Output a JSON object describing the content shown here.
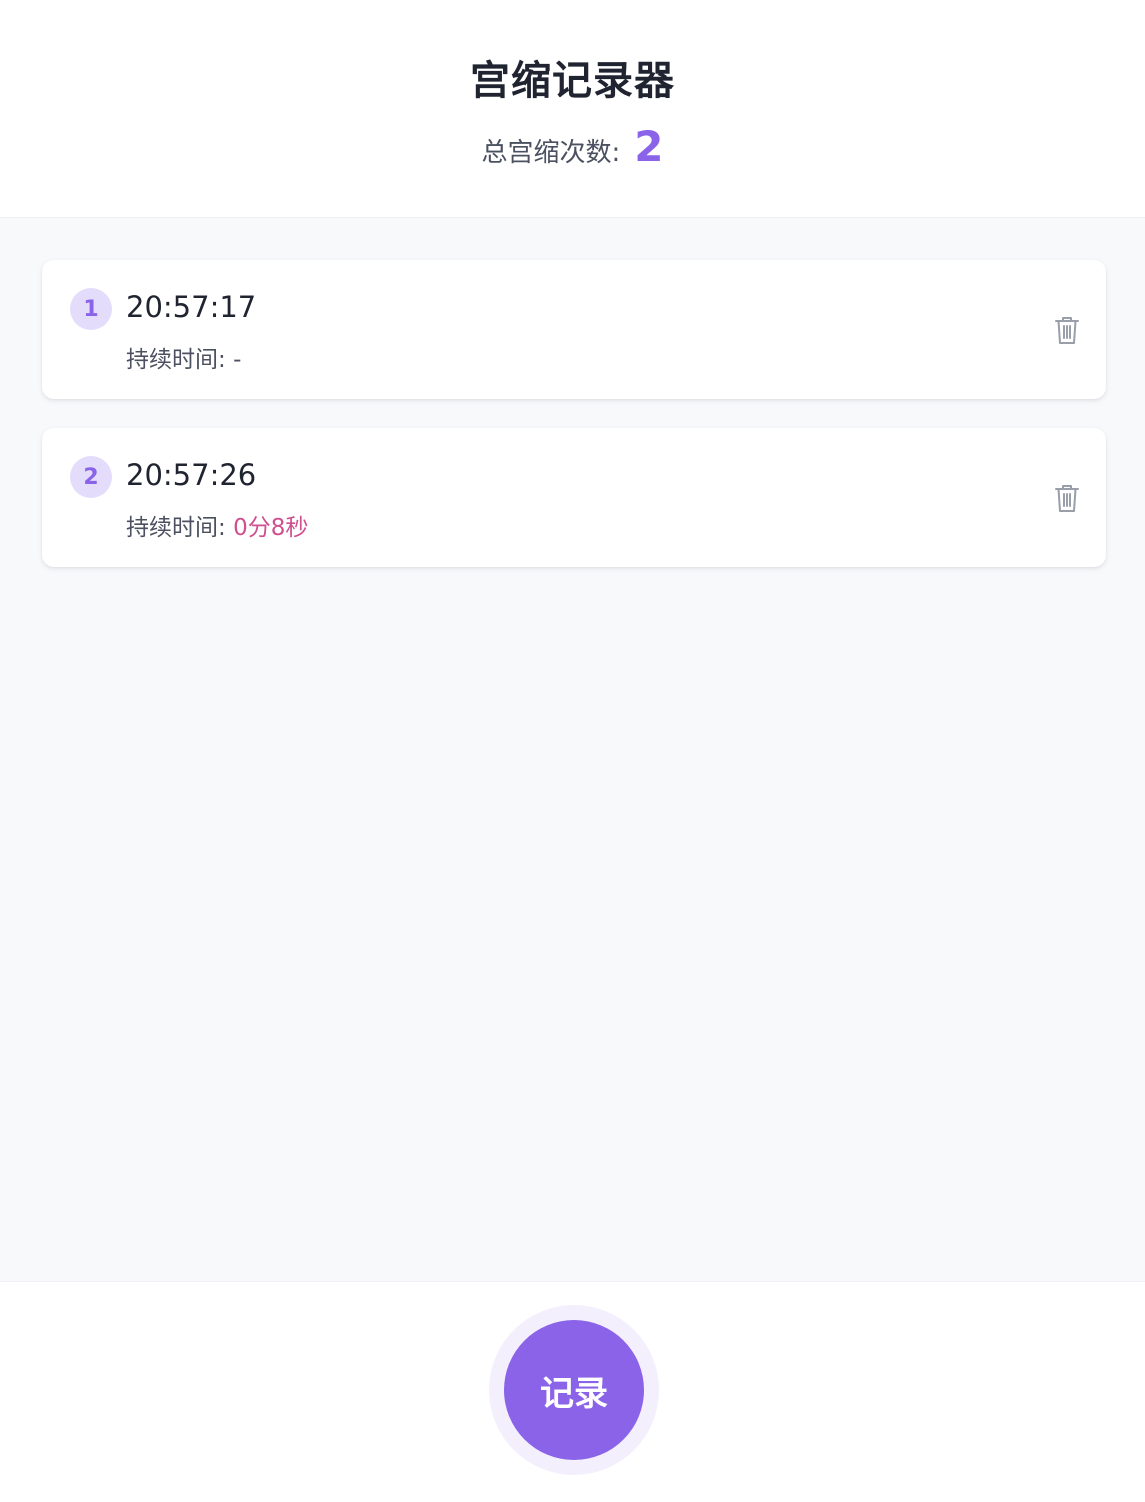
{
  "header": {
    "title": "宫缩记录器",
    "count_label": "总宫缩次数:",
    "count_value": "2"
  },
  "records": [
    {
      "index": "1",
      "time": "20:57:17",
      "duration_label": "持续时间:",
      "duration_value": "-"
    },
    {
      "index": "2",
      "time": "20:57:26",
      "duration_label": "持续时间:",
      "duration_value": "0分8秒"
    }
  ],
  "footer": {
    "record_button_label": "记录"
  },
  "colors": {
    "accent": "#8b63e8",
    "duration_highlight": "#cf4f8f",
    "badge_bg": "#e4dcfb"
  },
  "icons": {
    "delete": "trash-icon"
  }
}
